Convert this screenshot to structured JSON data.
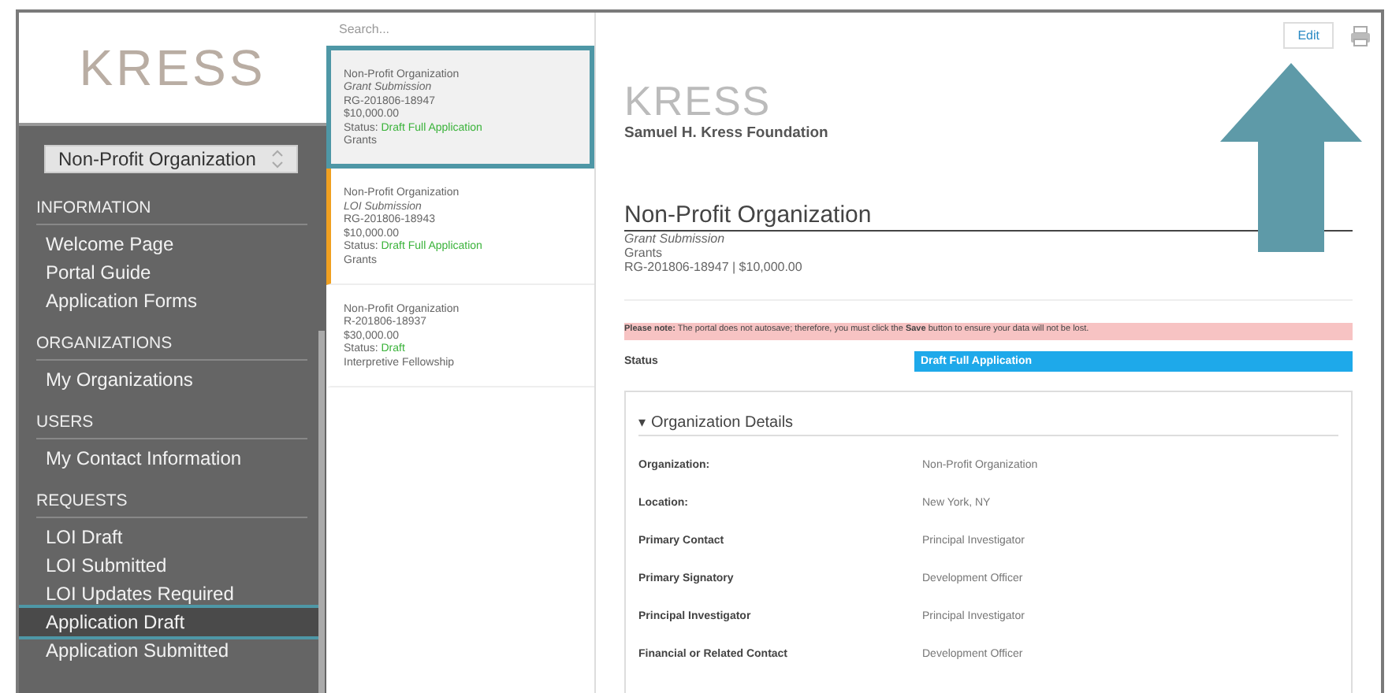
{
  "sidebar": {
    "logo": "KRESS",
    "org_select": "Non-Profit Organization",
    "sections": [
      {
        "heading": "INFORMATION",
        "items": [
          {
            "label": "Welcome Page",
            "selected": false
          },
          {
            "label": "Portal Guide",
            "selected": false
          },
          {
            "label": "Application Forms",
            "selected": false
          }
        ]
      },
      {
        "heading": "ORGANIZATIONS",
        "items": [
          {
            "label": "My Organizations",
            "selected": false
          }
        ]
      },
      {
        "heading": "USERS",
        "items": [
          {
            "label": "My Contact Information",
            "selected": false
          }
        ]
      },
      {
        "heading": "REQUESTS",
        "items": [
          {
            "label": "LOI Draft",
            "selected": false
          },
          {
            "label": "LOI Submitted",
            "selected": false
          },
          {
            "label": "LOI Updates Required",
            "selected": false
          },
          {
            "label": "Application Draft",
            "selected": true
          },
          {
            "label": "Application Submitted",
            "selected": false
          }
        ]
      }
    ]
  },
  "list": {
    "search": {
      "placeholder": "Search..."
    },
    "cards": [
      {
        "selected": true,
        "flagged": false,
        "lines": [
          {
            "text": "Non-Profit Organization",
            "italic": false
          },
          {
            "text": "Grant Submission",
            "italic": true
          },
          {
            "text": "RG-201806-18947",
            "italic": false
          },
          {
            "text": "$10,000.00",
            "italic": false
          }
        ],
        "status_label": "Status:",
        "status": "Draft Full Application",
        "program": "Grants"
      },
      {
        "selected": false,
        "flagged": true,
        "lines": [
          {
            "text": "Non-Profit Organization",
            "italic": false
          },
          {
            "text": "LOI Submission",
            "italic": true
          },
          {
            "text": "RG-201806-18943",
            "italic": false
          },
          {
            "text": "$10,000.00",
            "italic": false
          }
        ],
        "status_label": "Status:",
        "status": "Draft Full Application",
        "program": "Grants"
      },
      {
        "selected": false,
        "flagged": false,
        "lines": [
          {
            "text": "Non-Profit Organization",
            "italic": false
          },
          {
            "text": "R-201806-18937",
            "italic": false
          },
          {
            "text": "$30,000.00",
            "italic": false
          }
        ],
        "status_label": "Status:",
        "status": "Draft",
        "program": "Interpretive Fellowship"
      }
    ]
  },
  "main": {
    "edit_button": "Edit",
    "logo": "KRESS",
    "foundation": "Samuel H. Kress Foundation",
    "title": "Non-Profit Organization",
    "subtitle": "Grant Submission",
    "program": "Grants",
    "reference": "RG-201806-18947 | $10,000.00",
    "notice": "**Please note:** The portal does not autosave; therefore, you must click the **Save** button to ensure your data will not be lost.",
    "status_label": "Status",
    "status": "Draft Full Application",
    "details": {
      "toggle": "▾",
      "title": "Organization Details",
      "expanded": true,
      "rows": [
        {
          "label": "Organization:",
          "value": "Non-Profit Organization"
        },
        {
          "label": "Location:",
          "value": "New York, NY"
        },
        {
          "label": "Primary Contact",
          "value": "Principal Investigator"
        },
        {
          "label": "Primary Signatory",
          "value": "Development Officer"
        },
        {
          "label": "Principal Investigator",
          "value": "Principal Investigator"
        },
        {
          "label": "Financial or Related Contact",
          "value": "Development Officer"
        }
      ]
    }
  }
}
